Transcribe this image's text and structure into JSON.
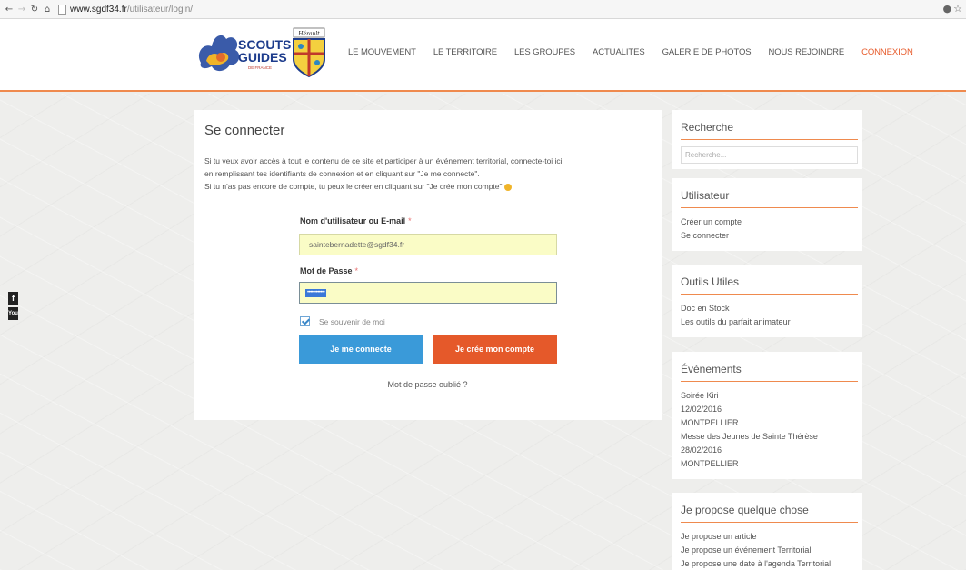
{
  "browser": {
    "url_host": "www.sgdf34.fr",
    "url_path": "/utilisateur/login/",
    "nav_icons": [
      "back-arrow-icon",
      "forward-arrow-icon",
      "reload-icon",
      "home-icon"
    ]
  },
  "header": {
    "logo_text": "SCOUTS GUIDES DE FRANCE",
    "nav": [
      {
        "label": "LE MOUVEMENT"
      },
      {
        "label": "LE TERRITOIRE"
      },
      {
        "label": "LES GROUPES"
      },
      {
        "label": "ACTUALITES"
      },
      {
        "label": "GALERIE DE PHOTOS"
      },
      {
        "label": "NOUS REJOINDRE"
      },
      {
        "label": "CONNEXION",
        "active": true
      }
    ],
    "accent_color": "#ef8a4e"
  },
  "social": [
    "f",
    "You"
  ],
  "login": {
    "title": "Se connecter",
    "intro_line1": "Si tu veux avoir accès à tout le contenu de ce site et participer à un événement territorial, connecte-toi ici",
    "intro_line2": "en remplissant tes identifiants de connexion et en cliquant sur \"Je me connecte\".",
    "intro_line3": "Si tu n'as pas encore de compte, tu peux le créer en cliquant sur \"Je crée mon compte\"",
    "username_label": "Nom d'utilisateur ou E-mail",
    "username_value": "saintebernadette@sgdf34.fr",
    "password_label": "Mot de Passe",
    "password_value": "••••••••••••",
    "required_mark": "*",
    "remember_label": "Se souvenir de moi",
    "login_button": "Je me connecte",
    "create_button": "Je crée mon compte",
    "forgot_link": "Mot de passe oublié ?",
    "login_button_color": "#3a9ad9",
    "create_button_color": "#e5592a"
  },
  "sidebar": {
    "search": {
      "title": "Recherche",
      "placeholder": "Recherche..."
    },
    "user": {
      "title": "Utilisateur",
      "items": [
        "Créer un compte",
        "Se connecter"
      ]
    },
    "tools": {
      "title": "Outils Utiles",
      "items": [
        "Doc en Stock",
        "Les outils du parfait animateur"
      ]
    },
    "events": {
      "title": "Événements",
      "items": [
        "Soirée Kiri",
        "12/02/2016",
        "MONTPELLIER",
        "Messe des Jeunes de Sainte Thérèse",
        "28/02/2016",
        "MONTPELLIER"
      ]
    },
    "propose": {
      "title": "Je propose quelque chose",
      "items": [
        "Je propose un article",
        "Je propose un événement Territorial",
        "Je propose une date à l'agenda Territorial"
      ]
    }
  }
}
